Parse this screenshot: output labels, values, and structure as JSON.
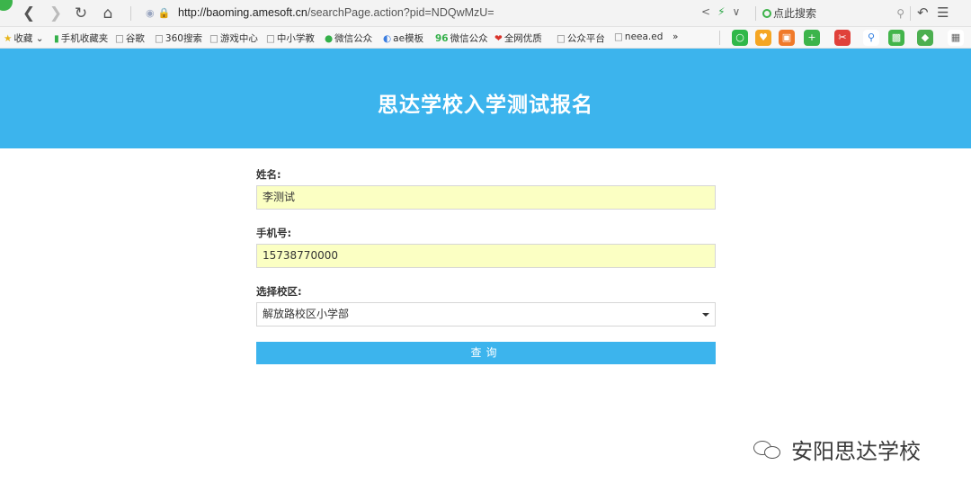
{
  "browser": {
    "url_host": "http://baoming.amesoft.cn",
    "url_path": "/searchPage.action?pid=NDQwMzU=",
    "search_placeholder": "点此搜索"
  },
  "bookmarks": [
    {
      "label": "收藏",
      "icon": "star-icon"
    },
    {
      "label": "手机收藏夹",
      "icon": "phone-icon"
    },
    {
      "label": "谷歌",
      "icon": "page-icon"
    },
    {
      "label": "360搜索",
      "icon": "page-icon"
    },
    {
      "label": "游戏中心",
      "icon": "page-icon"
    },
    {
      "label": "中小学教",
      "icon": "page-icon"
    },
    {
      "label": "微信公众",
      "icon": "wechat-icon"
    },
    {
      "label": "ae模板",
      "icon": "ae-icon"
    },
    {
      "label": "微信公众",
      "icon": "96-icon"
    },
    {
      "label": "全网优质",
      "icon": "heart-icon"
    },
    {
      "label": "公众平台",
      "icon": "page-icon"
    },
    {
      "label": "neea.ed",
      "icon": "page-icon"
    },
    {
      "label": "»",
      "icon": ""
    }
  ],
  "page": {
    "title": "思达学校入学测试报名",
    "name_label": "姓名:",
    "name_value": "李测试",
    "phone_label": "手机号:",
    "phone_value": "15738770000",
    "campus_label": "选择校区:",
    "campus_value": "解放路校区小学部",
    "query_button": "查询"
  },
  "watermark": {
    "text": "安阳思达学校"
  },
  "colors": {
    "banner": "#3cb4ed",
    "input_fill": "#fbffc3",
    "button": "#3cb4ed"
  }
}
